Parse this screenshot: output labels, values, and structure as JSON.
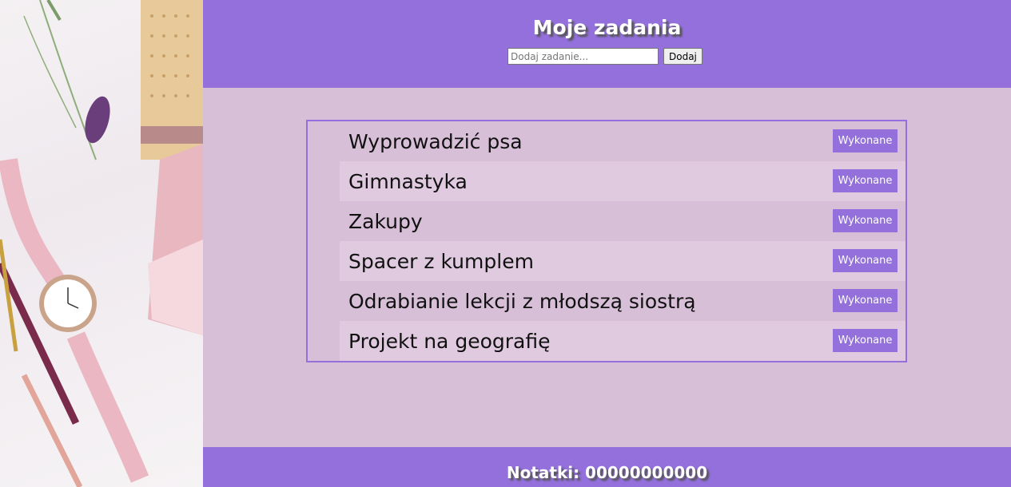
{
  "header": {
    "title": "Moje zadania",
    "input_placeholder": "Dodaj zadanie...",
    "add_label": "Dodaj"
  },
  "tasks": [
    {
      "text": "Wyprowadzić psa",
      "button": "Wykonane"
    },
    {
      "text": "Gimnastyka",
      "button": "Wykonane"
    },
    {
      "text": "Zakupy",
      "button": "Wykonane"
    },
    {
      "text": "Spacer z kumplem",
      "button": "Wykonane"
    },
    {
      "text": "Odrabianie lekcji z młodszą siostrą",
      "button": "Wykonane"
    },
    {
      "text": "Projekt na geografię",
      "button": "Wykonane"
    }
  ],
  "footer": {
    "text": "Notatki: 00000000000"
  },
  "colors": {
    "accent": "#9370db",
    "background": "#d8bfd8",
    "row_alt": "#dfcadf"
  }
}
